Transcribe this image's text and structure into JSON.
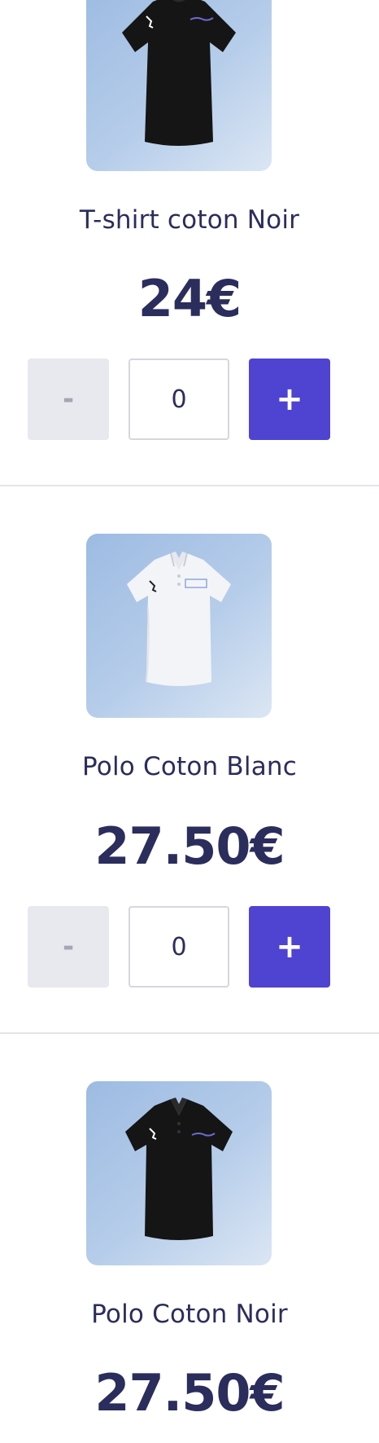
{
  "products": [
    {
      "name": "T-shirt coton Noir",
      "price": "24€",
      "minus_label": "-",
      "quantity": "0",
      "plus_label": "+",
      "image_icon": "black-tshirt-image"
    },
    {
      "name": "Polo Coton Blanc",
      "price": "27.50€",
      "minus_label": "-",
      "quantity": "0",
      "plus_label": "+",
      "image_icon": "white-polo-image"
    },
    {
      "name": "Polo Coton Noir",
      "price": "27.50€",
      "image_icon": "black-polo-image"
    }
  ],
  "colors": {
    "text": "#2b2d5c",
    "accent": "#4f43d2",
    "minus_bg": "#e8e9ef",
    "image_bg": "#b6cdea",
    "divider": "#e3e5ea"
  }
}
